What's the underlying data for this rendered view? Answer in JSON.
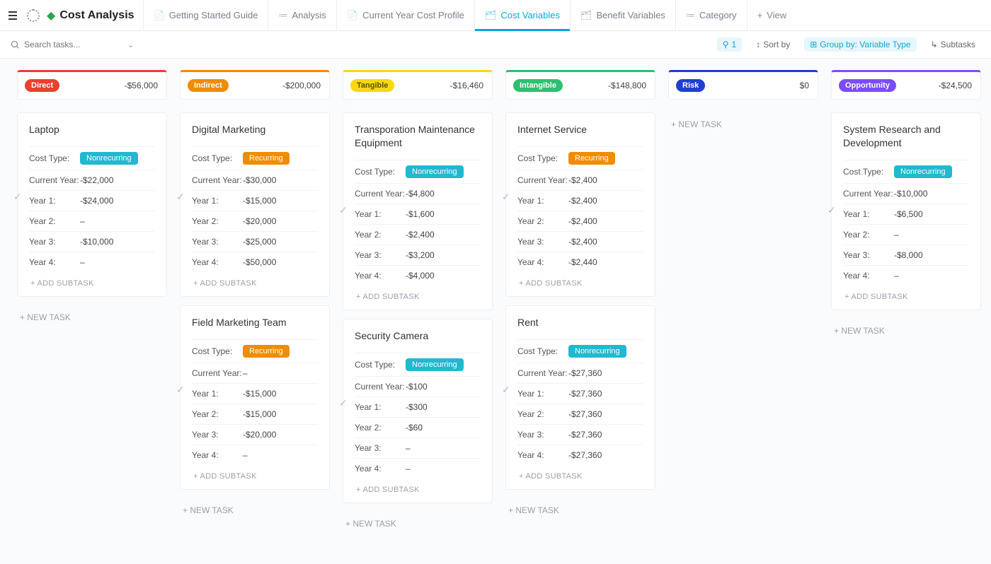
{
  "header": {
    "title": "Cost Analysis",
    "tabs": [
      {
        "label": "Getting Started Guide",
        "icon": "📄"
      },
      {
        "label": "Analysis",
        "icon": "≔"
      },
      {
        "label": "Current Year Cost Profile",
        "icon": "📄"
      },
      {
        "label": "Cost Variables",
        "icon": "🗂"
      },
      {
        "label": "Benefit Variables",
        "icon": "🗂"
      },
      {
        "label": "Category",
        "icon": "≔"
      }
    ],
    "active_tab_index": 3,
    "add_view_label": "View"
  },
  "filterbar": {
    "search_placeholder": "Search tasks...",
    "filter_count": "1",
    "sort_label": "Sort by",
    "group_label": "Group by: Variable Type",
    "subtasks_label": "Subtasks"
  },
  "labels": {
    "cost_type": "Cost Type:",
    "current_year": "Current Year:",
    "year1": "Year 1:",
    "year2": "Year 2:",
    "year3": "Year 3:",
    "year4": "Year 4:",
    "add_subtask": "ADD SUBTASK",
    "new_task": "NEW TASK",
    "ct_nonrecurring": "Nonrecurring",
    "ct_recurring": "Recurring"
  },
  "columns": [
    {
      "name": "Direct",
      "badge_color": "#e8412f",
      "border_color": "#e8412f",
      "total": "-$56,000",
      "cards": [
        {
          "title": "Laptop",
          "cost_type": "Nonrecurring",
          "check_row": "year1",
          "current_year": "-$22,000",
          "year1": "-$24,000",
          "year2": "–",
          "year3": "-$10,000",
          "year4": "–"
        }
      ]
    },
    {
      "name": "Indirect",
      "badge_color": "#f08c00",
      "border_color": "#f08c00",
      "total": "-$200,000",
      "cards": [
        {
          "title": "Digital Marketing",
          "cost_type": "Recurring",
          "check_row": "year1",
          "current_year": "-$30,000",
          "year1": "-$15,000",
          "year2": "-$20,000",
          "year3": "-$25,000",
          "year4": "-$50,000"
        },
        {
          "title": "Field Marketing Team",
          "cost_type": "Recurring",
          "check_row": "year1",
          "current_year": "–",
          "year1": "-$15,000",
          "year2": "-$15,000",
          "year3": "-$20,000",
          "year4": "–"
        }
      ]
    },
    {
      "name": "Tangible",
      "badge_color": "#f8d90f",
      "badge_text_color": "#5a5200",
      "border_color": "#f8d90f",
      "total": "-$16,460",
      "cards": [
        {
          "title": "Transporation Maintenance Equipment",
          "cost_type": "Nonrecurring",
          "check_row": "year1",
          "current_year": "-$4,800",
          "year1": "-$1,600",
          "year2": "-$2,400",
          "year3": "-$3,200",
          "year4": "-$4,000"
        },
        {
          "title": "Security Camera",
          "cost_type": "Nonrecurring",
          "check_row": "year1",
          "current_year": "-$100",
          "year1": "-$300",
          "year2": "-$60",
          "year3": "–",
          "year4": "–"
        }
      ]
    },
    {
      "name": "Intangible",
      "badge_color": "#2fbf71",
      "border_color": "#2fbf71",
      "total": "-$148,800",
      "cards": [
        {
          "title": "Internet Service",
          "cost_type": "Recurring",
          "check_row": "year1",
          "current_year": "-$2,400",
          "year1": "-$2,400",
          "year2": "-$2,400",
          "year3": "-$2,400",
          "year4": "-$2,440"
        },
        {
          "title": "Rent",
          "cost_type": "Nonrecurring",
          "check_row": "year1",
          "current_year": "-$27,360",
          "year1": "-$27,360",
          "year2": "-$27,360",
          "year3": "-$27,360",
          "year4": "-$27,360"
        }
      ]
    },
    {
      "name": "Risk",
      "badge_color": "#1f3fd1",
      "border_color": "#1f3fd1",
      "total": "$0",
      "cards": []
    },
    {
      "name": "Opportunity",
      "badge_color": "#7c4dff",
      "border_color": "#7c4dff",
      "total": "-$24,500",
      "cards": [
        {
          "title": "System Research and Development",
          "cost_type": "Nonrecurring",
          "check_row": "year1",
          "current_year": "-$10,000",
          "year1": "-$6,500",
          "year2": "–",
          "year3": "-$8,000",
          "year4": "–"
        }
      ]
    }
  ]
}
